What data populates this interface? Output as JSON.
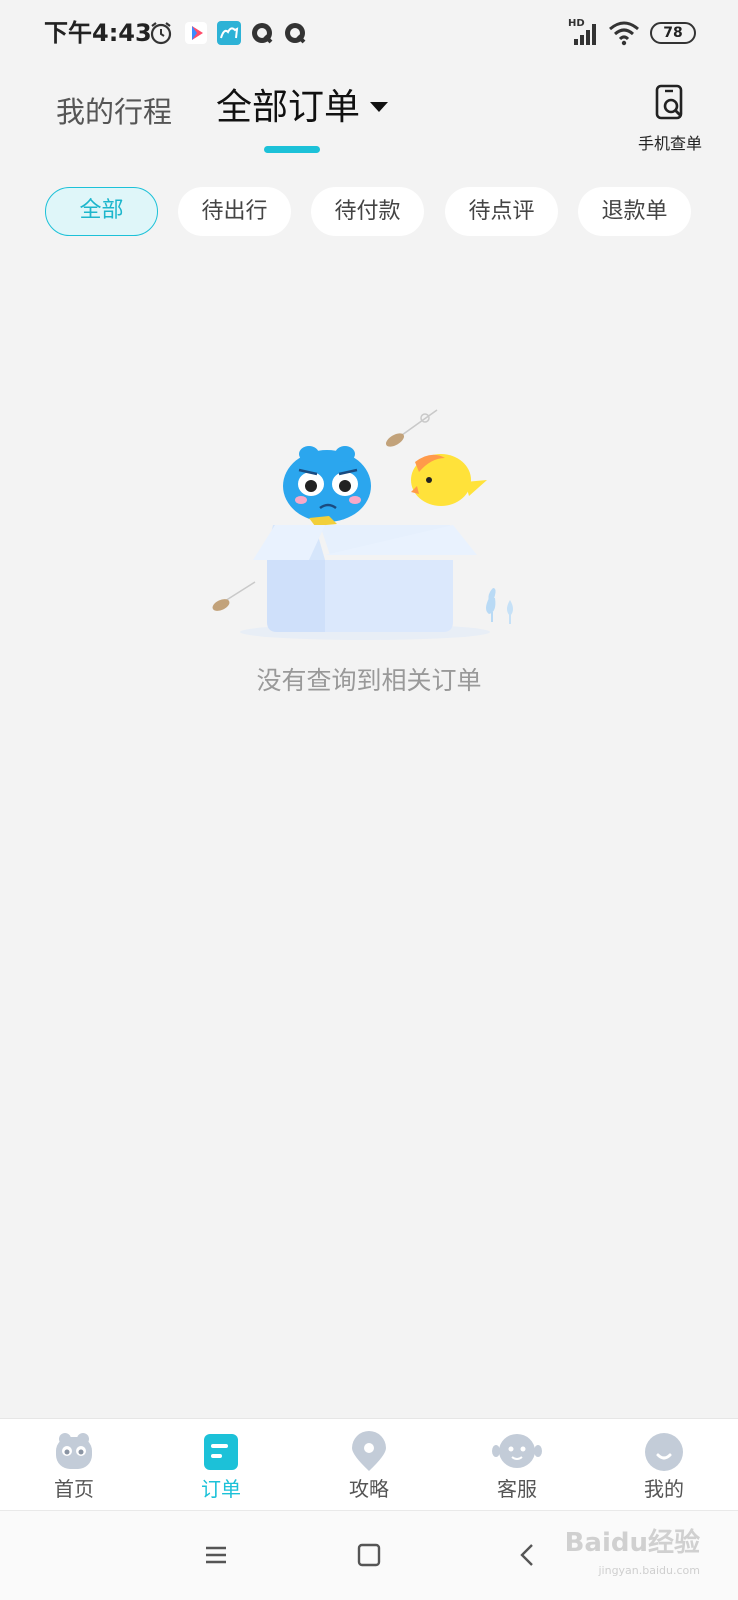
{
  "status_bar": {
    "time": "下午4:43",
    "signal_label": "HD",
    "battery": "78",
    "icons": [
      "alarm-icon",
      "video-app-icon",
      "camel-app-icon",
      "q-app-icon",
      "q-app-icon",
      "signal-icon",
      "wifi-icon",
      "battery-icon"
    ]
  },
  "header": {
    "tab_trips": "我的行程",
    "tab_orders": "全部订单",
    "phone_lookup_label": "手机查单",
    "accent_color": "#1cc1d8"
  },
  "filters": {
    "items": [
      "全部",
      "待出行",
      "待付款",
      "待点评",
      "退款单"
    ],
    "selected": "全部"
  },
  "empty_state": {
    "message": "没有查询到相关订单"
  },
  "bottom_nav": {
    "items": [
      {
        "label": "首页",
        "icon": "home-mascot-icon"
      },
      {
        "label": "订单",
        "icon": "order-icon"
      },
      {
        "label": "攻略",
        "icon": "location-pin-icon"
      },
      {
        "label": "客服",
        "icon": "customer-service-icon"
      },
      {
        "label": "我的",
        "icon": "profile-smile-icon"
      }
    ],
    "active": "订单"
  },
  "system_nav": {
    "icons": [
      "menu-icon",
      "home-square-icon",
      "back-icon"
    ]
  },
  "watermark": {
    "text": "Baidu经验",
    "sub": "jingyan.baidu.com"
  }
}
